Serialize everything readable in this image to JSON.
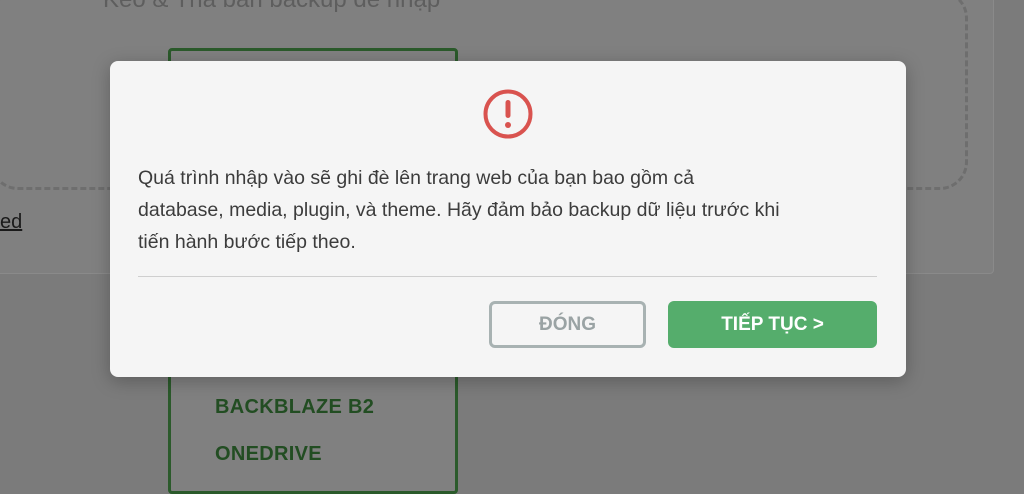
{
  "background": {
    "heading": "Kéo & Thả bản backup để nhập",
    "link_text": "ed",
    "services": [
      "BACKBLAZE B2",
      "ONEDRIVE"
    ]
  },
  "modal": {
    "icon": "exclamation-circle-icon",
    "icon_color": "#d9534f",
    "message_lines": [
      "Quá trình nhập vào sẽ ghi đè lên trang web của bạn bao gồm cả",
      "database, media, plugin, và theme. Hãy đảm bảo backup dữ liệu trước khi",
      "tiến hành bước tiếp theo."
    ],
    "close_label": "ĐÓNG",
    "continue_label": "TIẾP TỤC >",
    "accent_color": "#55ad6c"
  }
}
